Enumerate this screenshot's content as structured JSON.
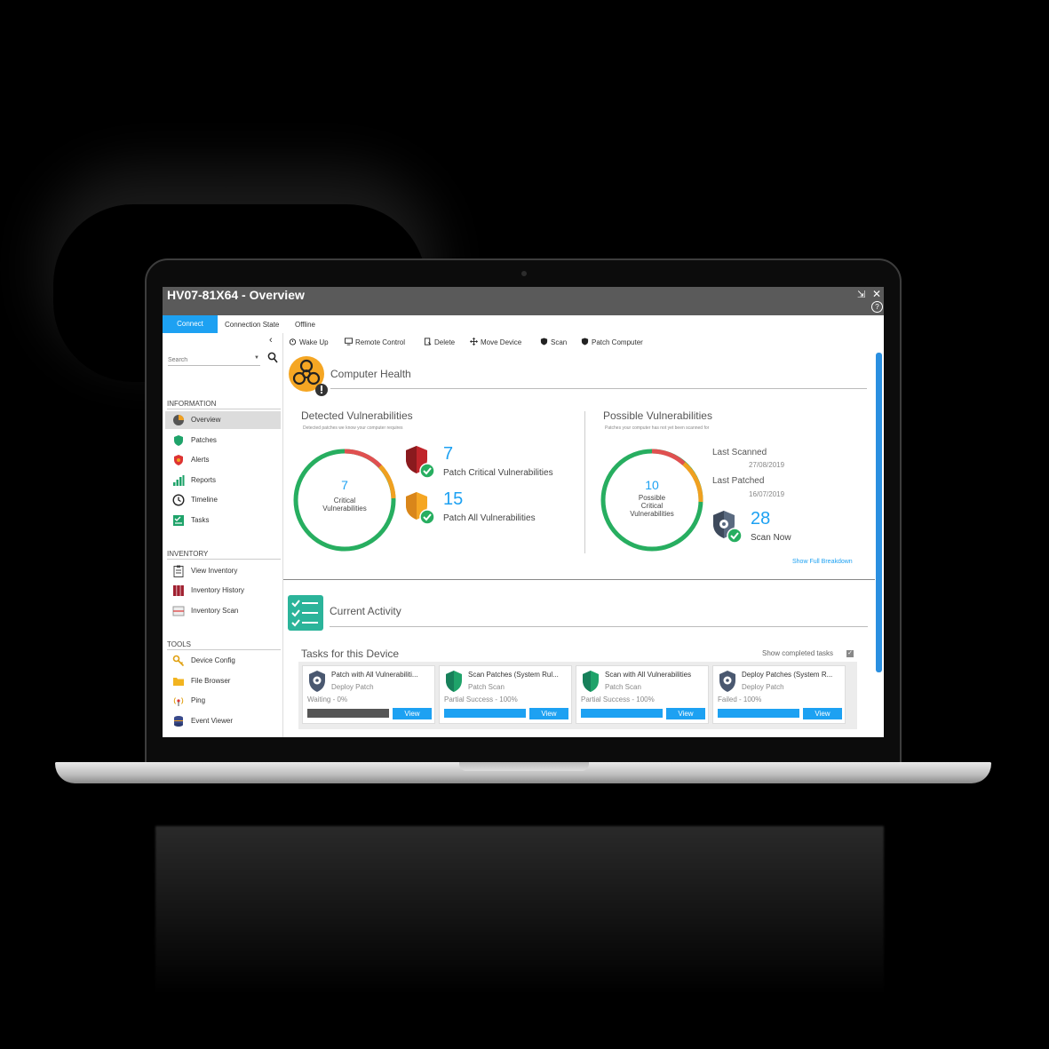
{
  "window": {
    "title": "HV07-81X64 - Overview",
    "help_glyph": "?"
  },
  "connection": {
    "connect_label": "Connect",
    "state_label": "Connection State",
    "state_value": "Offline"
  },
  "toolbar": {
    "wake_up": "Wake Up",
    "remote_control": "Remote Control",
    "delete": "Delete",
    "move_device": "Move Device",
    "scan": "Scan",
    "patch_computer": "Patch Computer"
  },
  "sidebar": {
    "search_placeholder": "Search",
    "information_header": "INFORMATION",
    "information_items": [
      {
        "label": "Overview",
        "icon": "overview-icon",
        "active": true
      },
      {
        "label": "Patches",
        "icon": "shield-icon"
      },
      {
        "label": "Alerts",
        "icon": "alert-icon"
      },
      {
        "label": "Reports",
        "icon": "bar-chart-icon"
      },
      {
        "label": "Timeline",
        "icon": "clock-icon"
      },
      {
        "label": "Tasks",
        "icon": "tasks-icon"
      }
    ],
    "inventory_header": "INVENTORY",
    "inventory_items": [
      {
        "label": "View Inventory",
        "icon": "clipboard-icon"
      },
      {
        "label": "Inventory History",
        "icon": "binders-icon"
      },
      {
        "label": "Inventory Scan",
        "icon": "scan-icon"
      }
    ],
    "tools_header": "TOOLS",
    "tools_items": [
      {
        "label": "Device Config",
        "icon": "key-icon"
      },
      {
        "label": "File Browser",
        "icon": "folder-icon"
      },
      {
        "label": "Ping",
        "icon": "ping-icon"
      },
      {
        "label": "Event Viewer",
        "icon": "database-icon"
      }
    ]
  },
  "health": {
    "title": "Computer Health",
    "detected": {
      "title": "Detected Vulnerabilities",
      "subtitle": "Detected patches we know your computer requires",
      "ring_value": "7",
      "ring_label_1": "Critical",
      "ring_label_2": "Vulnerabilities",
      "critical_count": "7",
      "critical_label": "Patch Critical Vulnerabilities",
      "all_count": "15",
      "all_label": "Patch All Vulnerabilities"
    },
    "possible": {
      "title": "Possible Vulnerabilities",
      "subtitle": "Patches your computer has not yet been scanned for",
      "ring_value": "10",
      "ring_label_1": "Possible",
      "ring_label_2": "Critical",
      "ring_label_3": "Vulnerabilities",
      "last_scanned_label": "Last Scanned",
      "last_scanned_value": "27/08/2019",
      "last_patched_label": "Last Patched",
      "last_patched_value": "16/07/2019",
      "scan_count": "28",
      "scan_label": "Scan Now",
      "breakdown_link": "Show Full Breakdown"
    }
  },
  "activity": {
    "title": "Current Activity",
    "tasks_title": "Tasks for this Device",
    "show_completed": "Show completed tasks",
    "tasks": [
      {
        "title": "Patch with All Vulnerabiliti...",
        "type": "Deploy Patch",
        "status": "Waiting - 0%",
        "progress": 0,
        "view": "View",
        "icon": "gear-shield-icon"
      },
      {
        "title": "Scan Patches (System Rul...",
        "type": "Patch Scan",
        "status": "Partial Success - 100%",
        "progress": 100,
        "view": "View",
        "icon": "green-shield-icon"
      },
      {
        "title": "Scan with All Vulnerabilities",
        "type": "Patch Scan",
        "status": "Partial Success - 100%",
        "progress": 100,
        "view": "View",
        "icon": "green-shield-icon"
      },
      {
        "title": "Deploy Patches (System R...",
        "type": "Deploy Patch",
        "status": "Failed - 100%",
        "progress": 100,
        "view": "View",
        "icon": "gear-shield-icon"
      }
    ]
  },
  "colors": {
    "accent": "#1da1f2",
    "success": "#27ae60",
    "warning": "#f0a020",
    "danger": "#e03c3c"
  }
}
